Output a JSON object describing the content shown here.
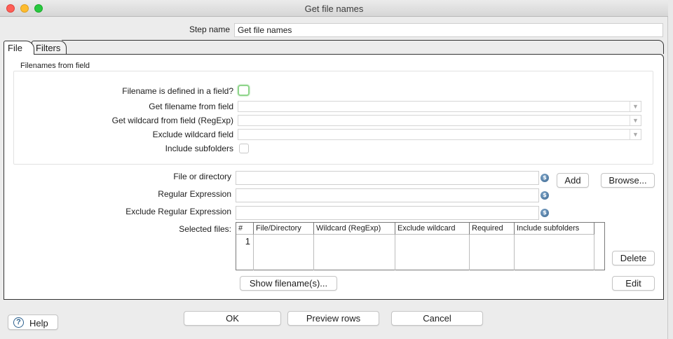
{
  "window": {
    "title": "Get file names"
  },
  "step": {
    "label": "Step name",
    "value": "Get file names"
  },
  "tabs": [
    {
      "label": "File",
      "active": true
    },
    {
      "label": "Filters",
      "active": false
    }
  ],
  "filenames_group": {
    "title": "Filenames from field",
    "defined_in_field_label": "Filename is defined in a field?",
    "get_filename_label": "Get filename from field",
    "get_wildcard_label": "Get wildcard from field (RegExp)",
    "exclude_wildcard_label": "Exclude wildcard field",
    "include_subfolders_label": "Include subfolders"
  },
  "file_section": {
    "file_or_directory_label": "File or directory",
    "regex_label": "Regular Expression",
    "exclude_regex_label": "Exclude Regular Expression",
    "selected_files_label": "Selected files:",
    "add_label": "Add",
    "browse_label": "Browse...",
    "delete_label": "Delete",
    "edit_label": "Edit",
    "show_filenames_label": "Show filename(s)...",
    "variable_icon": "$"
  },
  "table": {
    "columns": [
      "#",
      "File/Directory",
      "Wildcard (RegExp)",
      "Exclude wildcard",
      "Required",
      "Include subfolders"
    ],
    "rows": [
      {
        "num": "1",
        "file": "",
        "wildcard": "",
        "exclude": "",
        "required": "",
        "subfolders": ""
      }
    ]
  },
  "footer": {
    "help_label": "Help",
    "help_icon": "?",
    "ok_label": "OK",
    "preview_label": "Preview rows",
    "cancel_label": "Cancel"
  },
  "colors": {
    "focus_ring": "#8fd58b",
    "close": "#fe5f57",
    "minimize": "#febc2e",
    "maximize": "#28c840"
  }
}
